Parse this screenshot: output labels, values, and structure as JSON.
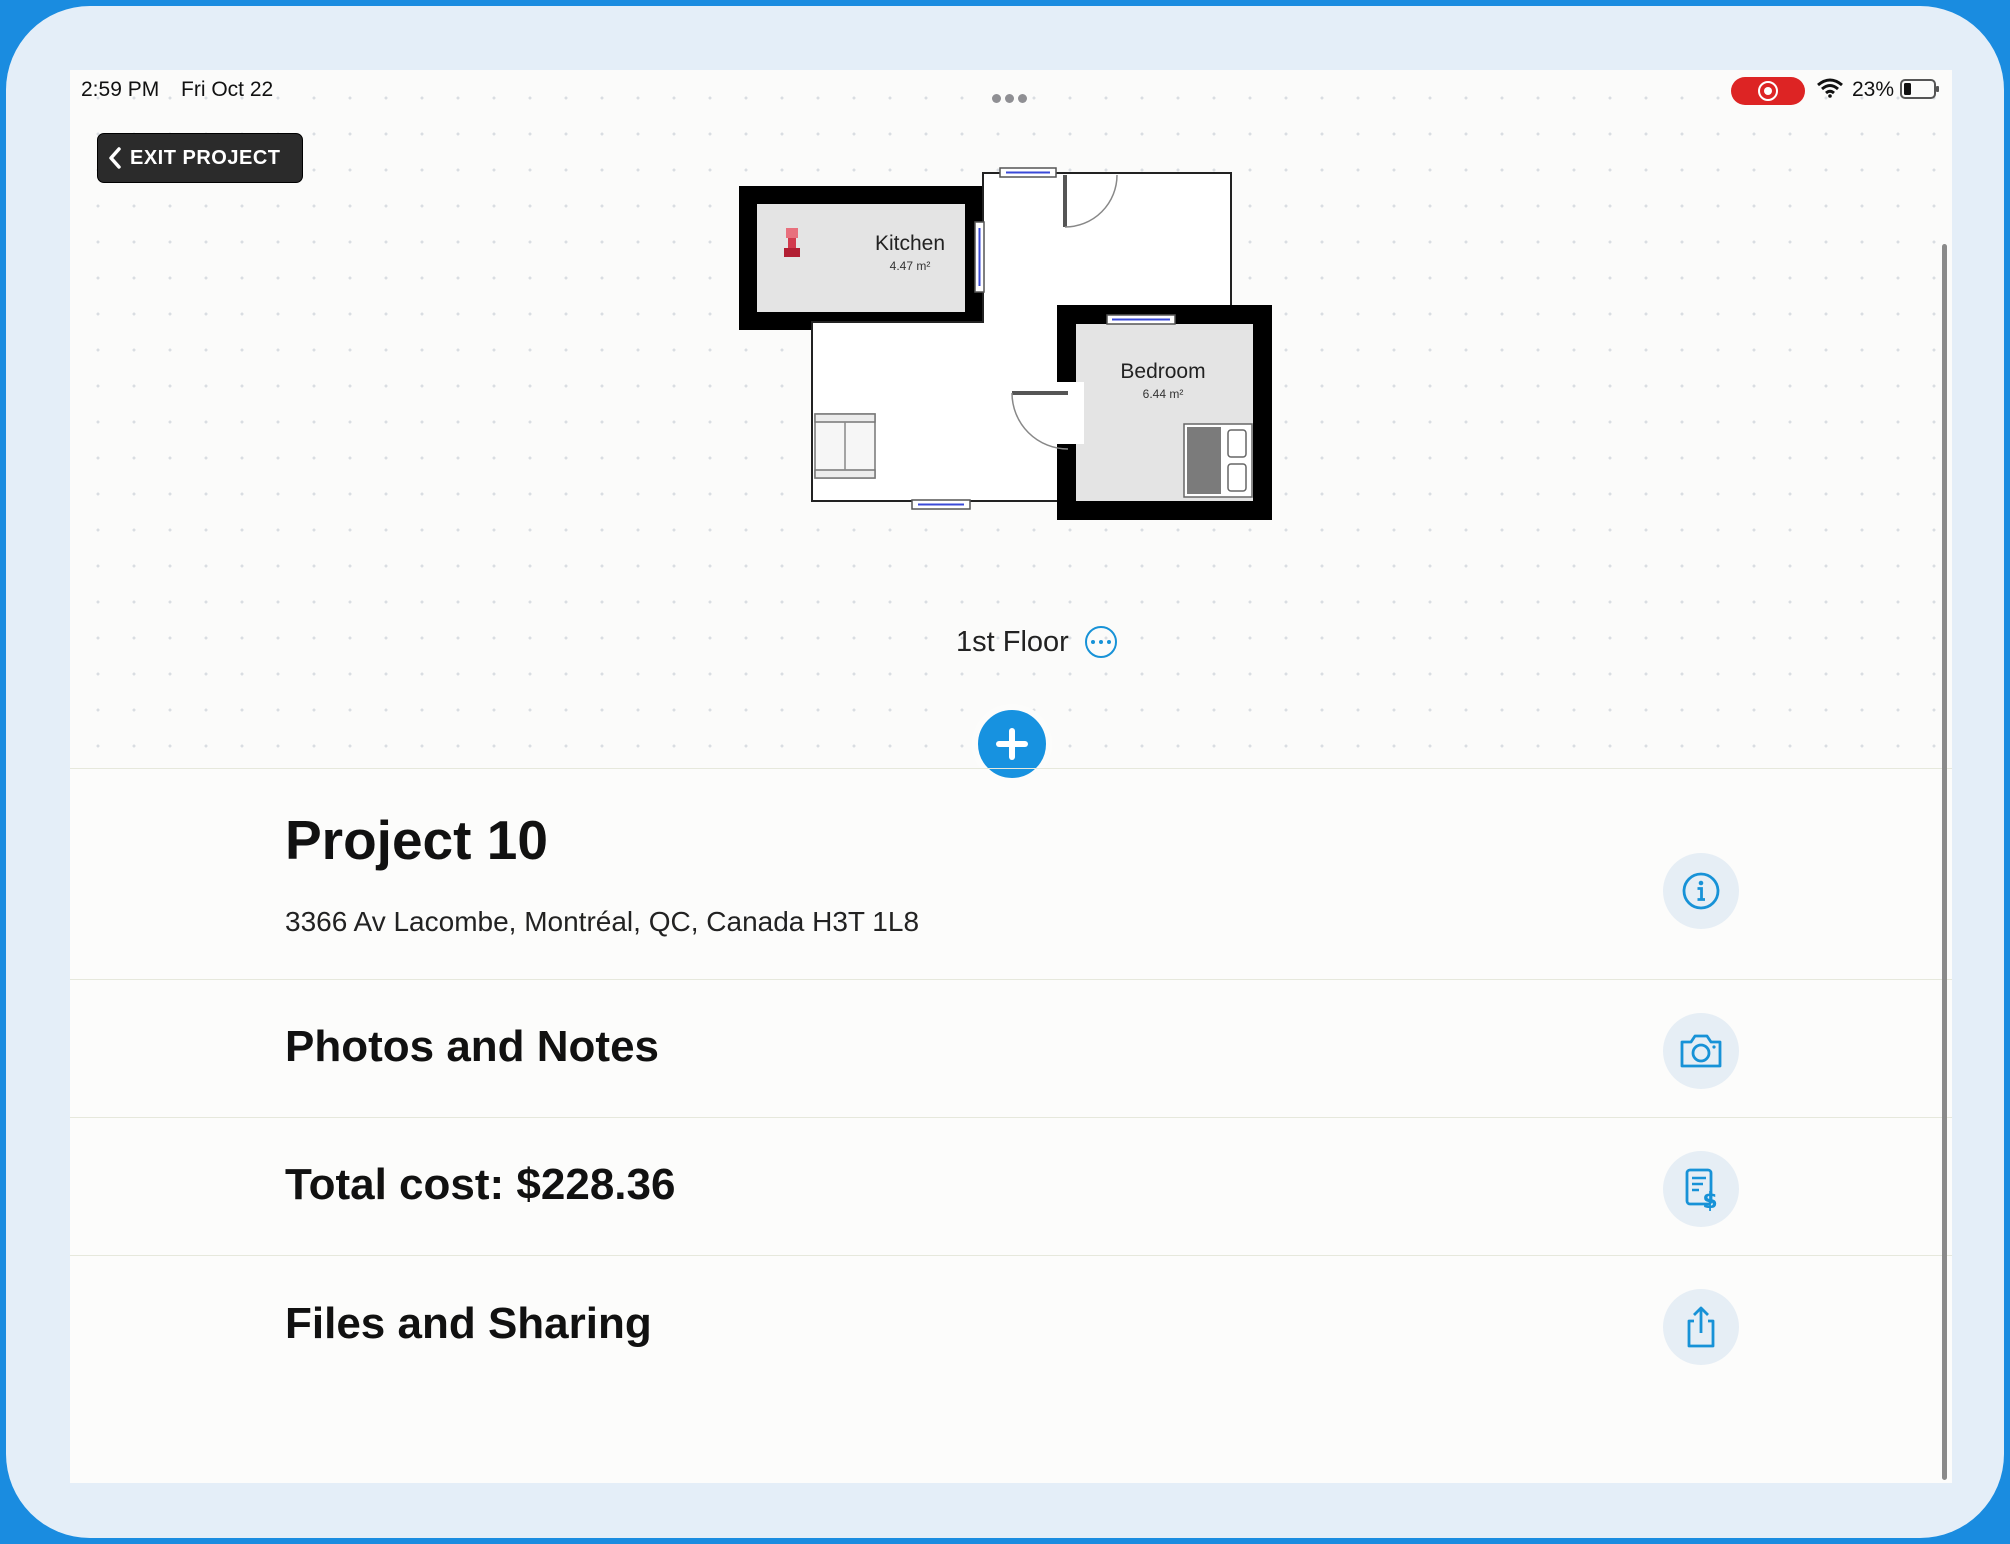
{
  "status_bar": {
    "time": "2:59 PM",
    "date": "Fri Oct 22",
    "battery": "23%",
    "icons": [
      "record-icon",
      "wifi-icon",
      "battery-icon"
    ]
  },
  "header": {
    "exit_label": "EXIT PROJECT"
  },
  "floorplan": {
    "rooms": [
      {
        "name": "Kitchen",
        "area": "4.47 m²"
      },
      {
        "name": "Bedroom",
        "area": "6.44 m²"
      }
    ]
  },
  "floor": {
    "label": "1st Floor"
  },
  "project": {
    "title": "Project 10",
    "address": "3366 Av Lacombe, Montréal, QC, Canada H3T 1L8"
  },
  "sections": {
    "photos": "Photos and Notes",
    "cost": "Total cost: $228.36",
    "files": "Files and Sharing"
  },
  "colors": {
    "accent": "#1792e0",
    "record": "#dd2424",
    "exit_button": "#2b2b2b"
  }
}
